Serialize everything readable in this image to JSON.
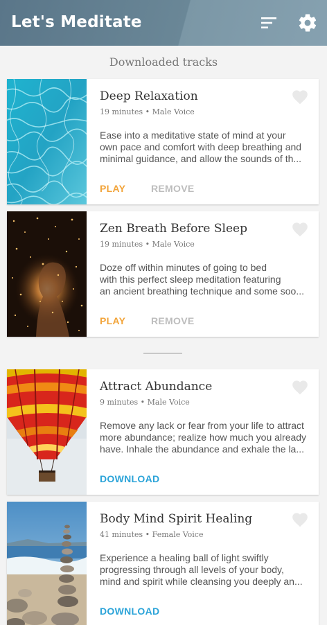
{
  "app": {
    "title": "Let's Meditate",
    "icons": {
      "filter": "sort-filter-icon",
      "settings": "gear-icon",
      "favorite": "heart-icon"
    }
  },
  "section": {
    "title": "Downloaded tracks"
  },
  "downloaded": [
    {
      "title": "Deep Relaxation",
      "meta": "19 minutes • Male Voice",
      "desc": [
        "Ease into a meditative state of mind at your",
        "own pace and comfort with deep breathing and",
        "minimal guidance, and allow the sounds of th..."
      ],
      "play": "PLAY",
      "remove": "REMOVE"
    },
    {
      "title": "Zen Breath Before Sleep",
      "meta": "19 minutes • Male Voice",
      "desc": [
        "Doze off within minutes of going to bed",
        "with this perfect sleep meditation featuring",
        "an ancient breathing technique and some soo..."
      ],
      "play": "PLAY",
      "remove": "REMOVE"
    }
  ],
  "available": [
    {
      "title": "Attract Abundance",
      "meta": "9 minutes • Male Voice",
      "desc": [
        "Remove any lack or fear from your life to attract",
        "more abundance; realize how much you already",
        "have. Inhale the abundance and exhale the la..."
      ],
      "download": "DOWNLOAD"
    },
    {
      "title": "Body Mind Spirit Healing",
      "meta": "41 minutes • Female Voice",
      "desc": [
        "Experience a healing ball of light swiftly",
        "progressing through all levels of your body,",
        "mind and spirit while cleansing you deeply an..."
      ],
      "download": "DOWNLOAD"
    }
  ],
  "colors": {
    "appbar": "#5a7689",
    "play": "#f2a43a",
    "remove": "#bdbdbd",
    "download": "#2aa3d8"
  }
}
